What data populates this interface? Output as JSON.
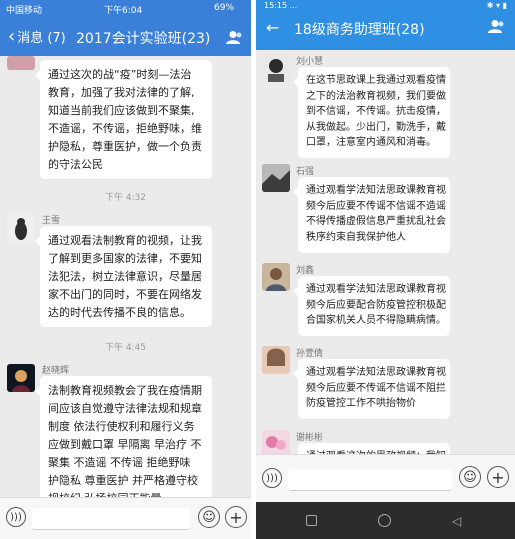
{
  "left": {
    "status": {
      "carrier": "中国移动",
      "time": "下午6:04",
      "battery": "69%"
    },
    "nav": {
      "back_label": "消息 (7)",
      "title": "2017会计实验班(23)"
    },
    "messages": [
      {
        "type": "text",
        "sender": "",
        "lines": [
          "通过这次的战“疫”时刻—法治",
          "教育，加强了我对法律的了解,",
          "知道当前我们应该做到不聚集,",
          "不造谣，不传谣，拒绝野味，维",
          "护隐私，尊重医护，做一个负责",
          "的守法公民"
        ]
      },
      {
        "type": "time",
        "text": "下午 4:32"
      },
      {
        "type": "text",
        "sender": "王雪",
        "lines": [
          "通过观看法制教育的视频，让我",
          "了解到更多国家的法律，不要知",
          "法犯法，树立法律意识，尽量居",
          "家不出门的同时，不要在网络发",
          "达的时代去传播不良的信息。"
        ]
      },
      {
        "type": "time",
        "text": "下午 4:45"
      },
      {
        "type": "text",
        "sender": "赵晓辉",
        "lines": [
          "法制教育视频教会了我在疫情期",
          "间应该自觉遵守法律法规和规章",
          "制度 依法行使权利和履行义务",
          "应做到戴口罩 早隔离 早治疗 不",
          "聚集 不造谣 不传谣 拒绝野味",
          "护隐私 尊重医护 并严格遵守校",
          "规校纪 弘扬校园正能量"
        ]
      }
    ]
  },
  "right": {
    "status": {
      "left": "15:15 ...",
      "right": "✱ ▾ ▮"
    },
    "nav": {
      "title": "18级商务助理班(28)"
    },
    "messages": [
      {
        "sender": "刘小慧",
        "lines": [
          "在这节思政课上我通过观看疫情",
          "之下的法治教育视频，我们要做",
          "到不信谣，不传谣。抗击疫情，",
          "从我做起。少出门，勤洗手，戴",
          "口罩，注意室内通风和消毒。"
        ]
      },
      {
        "sender": "石强",
        "lines": [
          "通过观看学法知法思政课教育视",
          "频今后应要不传谣不信谣不造谣",
          "不得传播虚假信息严重扰乱社会",
          "秩序约束自我保护他人"
        ]
      },
      {
        "sender": "刘鑫",
        "lines": [
          "通过观看学法知法思政课教育视",
          "频今后应要配合防疫管控积极配",
          "合国家机关人员不得隐瞒病情。"
        ]
      },
      {
        "sender": "孙萱倩",
        "lines": [
          "通过观看学法知法思政课教育视",
          "频今后应要不传谣不信谣不阻拦",
          "防疫管控工作不哄抬物价"
        ]
      },
      {
        "sender": "谢彬彬",
        "lines": [
          "通过观看这次的思政视频：我知"
        ]
      }
    ]
  },
  "icons": {
    "back": "chevron-left-icon",
    "group": "group-icon",
    "voice": "voice-icon",
    "emoji": "emoji-icon",
    "plus": "plus-icon"
  },
  "colors": {
    "left_nav": "#3a7fd8",
    "right_nav": "#2f8fe3",
    "chat_bg": "#ebebeb"
  }
}
